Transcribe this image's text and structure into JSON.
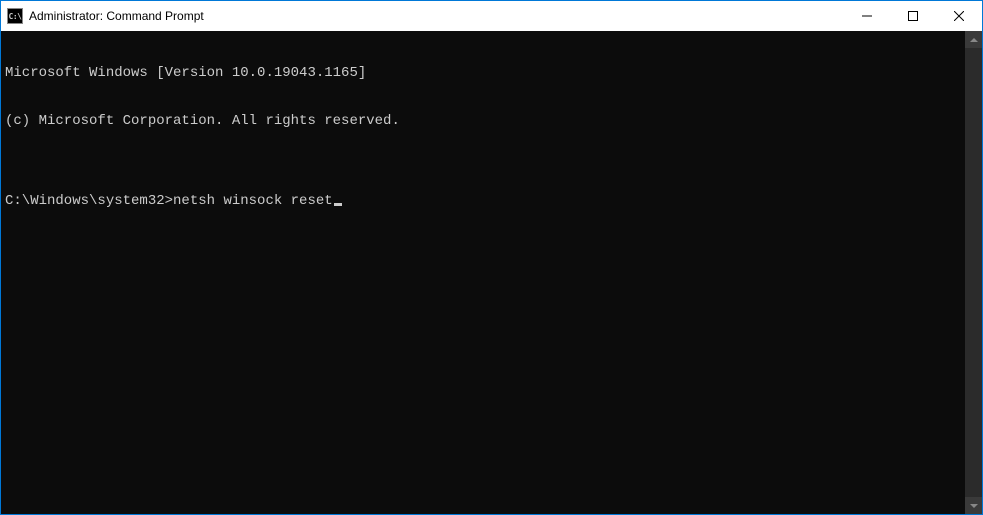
{
  "window": {
    "title": "Administrator: Command Prompt",
    "icon_label": "cmd-icon"
  },
  "controls": {
    "minimize": "minimize",
    "maximize": "maximize",
    "close": "close"
  },
  "terminal": {
    "line1": "Microsoft Windows [Version 10.0.19043.1165]",
    "line2": "(c) Microsoft Corporation. All rights reserved.",
    "blank": "",
    "prompt": "C:\\Windows\\system32>",
    "command": "netsh winsock reset"
  }
}
